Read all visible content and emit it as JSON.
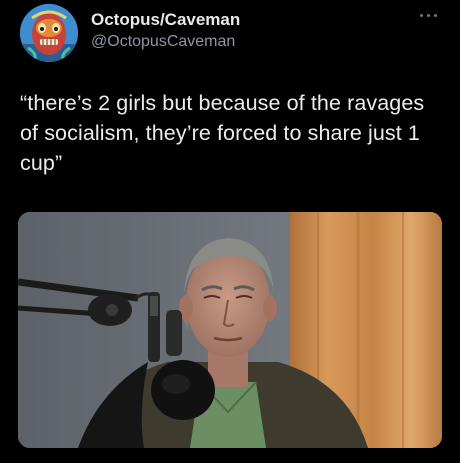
{
  "author": {
    "display_name": "Octopus/Caveman",
    "handle": "@OctopusCaveman",
    "avatar_icon": "painted-face-avatar"
  },
  "tweet": {
    "text": "“there’s 2 girls but because of the ravages of socialism, they’re forced to share just 1 cup”"
  },
  "media": {
    "type": "video-still",
    "subject": "man-at-microphone"
  },
  "colors": {
    "background": "#000000",
    "primary_text": "#e7e9ea",
    "secondary_text": "#8b98a5"
  }
}
